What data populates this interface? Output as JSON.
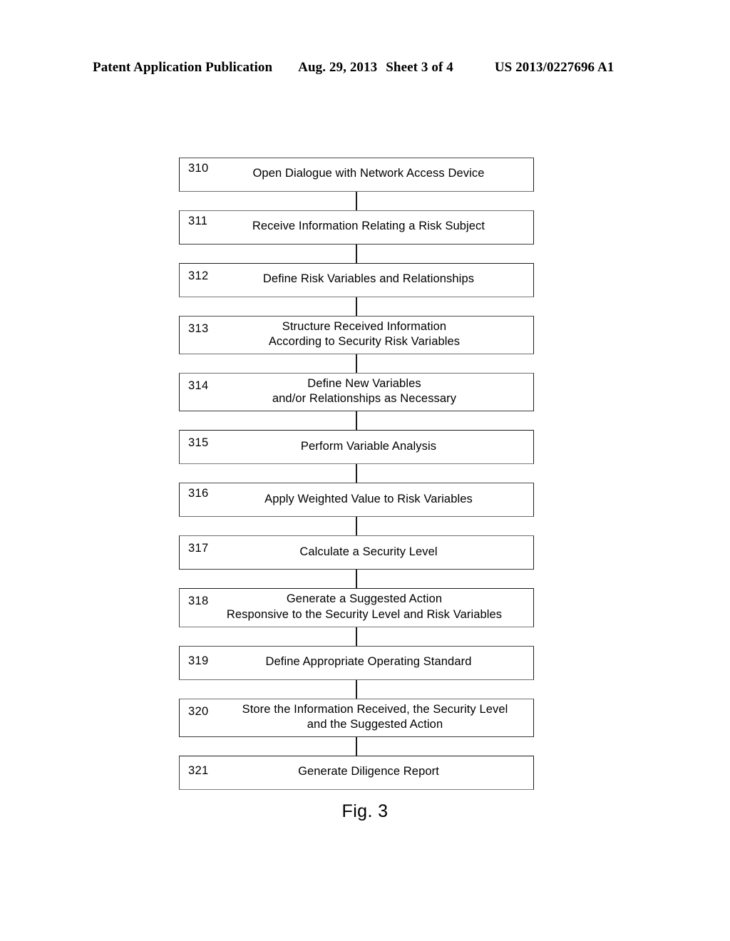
{
  "header": {
    "publication": "Patent Application Publication",
    "date": "Aug. 29, 2013",
    "sheet": "Sheet 3 of 4",
    "patent_number": "US 2013/0227696 A1"
  },
  "figure": {
    "caption": "Fig. 3",
    "nodes": [
      {
        "ref": "310",
        "label": "Open Dialogue with Network Access Device"
      },
      {
        "ref": "311",
        "label": "Receive Information Relating a Risk Subject"
      },
      {
        "ref": "312",
        "label": "Define Risk Variables and Relationships"
      },
      {
        "ref": "313",
        "label": "Structure Received Information\nAccording to Security Risk Variables"
      },
      {
        "ref": "314",
        "label": "Define New Variables\nand/or Relationships as Necessary"
      },
      {
        "ref": "315",
        "label": "Perform Variable Analysis"
      },
      {
        "ref": "316",
        "label": "Apply Weighted Value to Risk Variables"
      },
      {
        "ref": "317",
        "label": "Calculate a Security Level"
      },
      {
        "ref": "318",
        "label": "Generate a Suggested Action\nResponsive to the Security Level and Risk Variables"
      },
      {
        "ref": "319",
        "label": "Define Appropriate Operating Standard"
      },
      {
        "ref": "320",
        "label": "Store the Information Received, the Security Level\nand the Suggested Action"
      },
      {
        "ref": "321",
        "label": "Generate Diligence Report"
      }
    ]
  }
}
